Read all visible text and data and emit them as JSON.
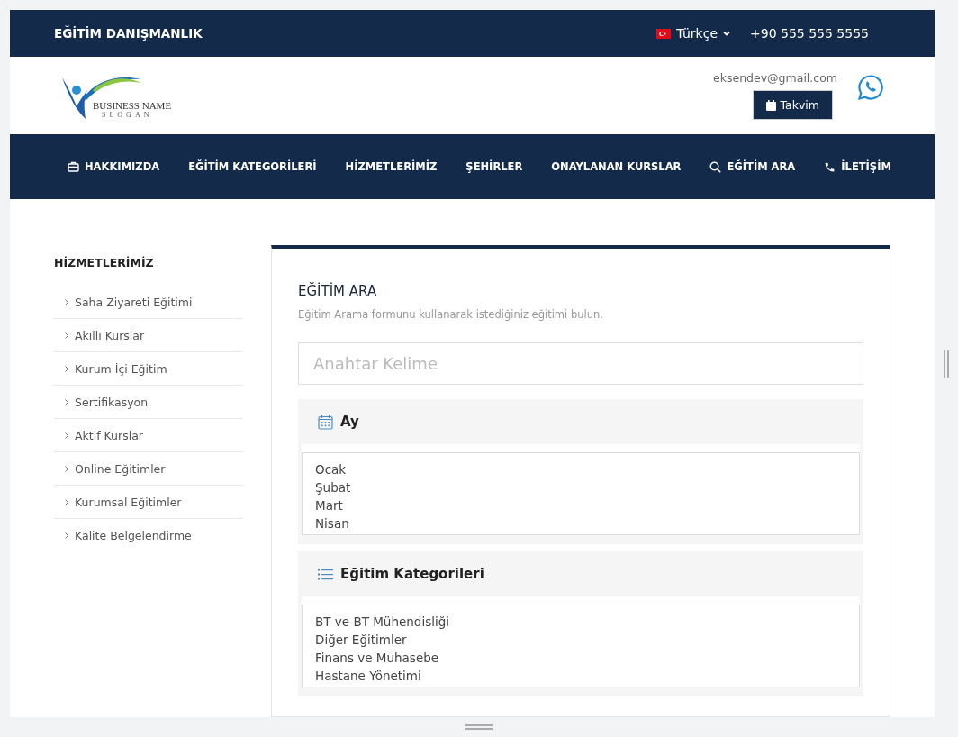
{
  "topbar": {
    "brand": "EĞİTİM DANIŞMANLIK",
    "language": "Türkçe",
    "phone": "+90 555 555 5555"
  },
  "header": {
    "logo_name": "BUSINESS NAME",
    "logo_slogan": "SLOGAN",
    "email": "eksendev@gmail.com",
    "calendar_button": "Takvim"
  },
  "nav": [
    {
      "label": "HAKKIMIZDA",
      "kind": "briefcase"
    },
    {
      "label": "EĞİTİM KATEGORİLERİ",
      "kind": "plain"
    },
    {
      "label": "HİZMETLERİMİZ",
      "kind": "plain"
    },
    {
      "label": "ŞEHİRLER",
      "kind": "plain"
    },
    {
      "label": "ONAYLANAN KURSLAR",
      "kind": "plain"
    },
    {
      "label": "EĞİTİM ARA",
      "kind": "search"
    },
    {
      "label": "İLETİŞİM",
      "kind": "phone"
    }
  ],
  "sidebar": {
    "title": "HİZMETLERİMİZ",
    "items": [
      "Saha Ziyareti Eğitimi",
      "Akıllı Kurslar",
      "Kurum İçi Eğitim",
      "Sertifikasyon",
      "Aktif Kurslar",
      "Online Eğitimler",
      "Kurumsal Eğitimler",
      "Kalite Belgelendirme"
    ]
  },
  "search": {
    "title": "EĞİTİM ARA",
    "subtitle": "Eğitim Arama formunu kullanarak istediğiniz eğitimi bulun.",
    "keyword": {
      "placeholder": "Anahtar Kelime"
    },
    "filters": [
      {
        "title": "Ay",
        "kind": "calendar",
        "options": [
          "Ocak",
          "Şubat",
          "Mart",
          "Nisan"
        ]
      },
      {
        "title": "Eğitim Kategorileri",
        "kind": "list",
        "options": [
          "BT ve BT Mühendisliği",
          "Diğer Eğitimler",
          "Finans ve Muhasebe",
          "Hastane Yönetimi"
        ]
      }
    ]
  }
}
